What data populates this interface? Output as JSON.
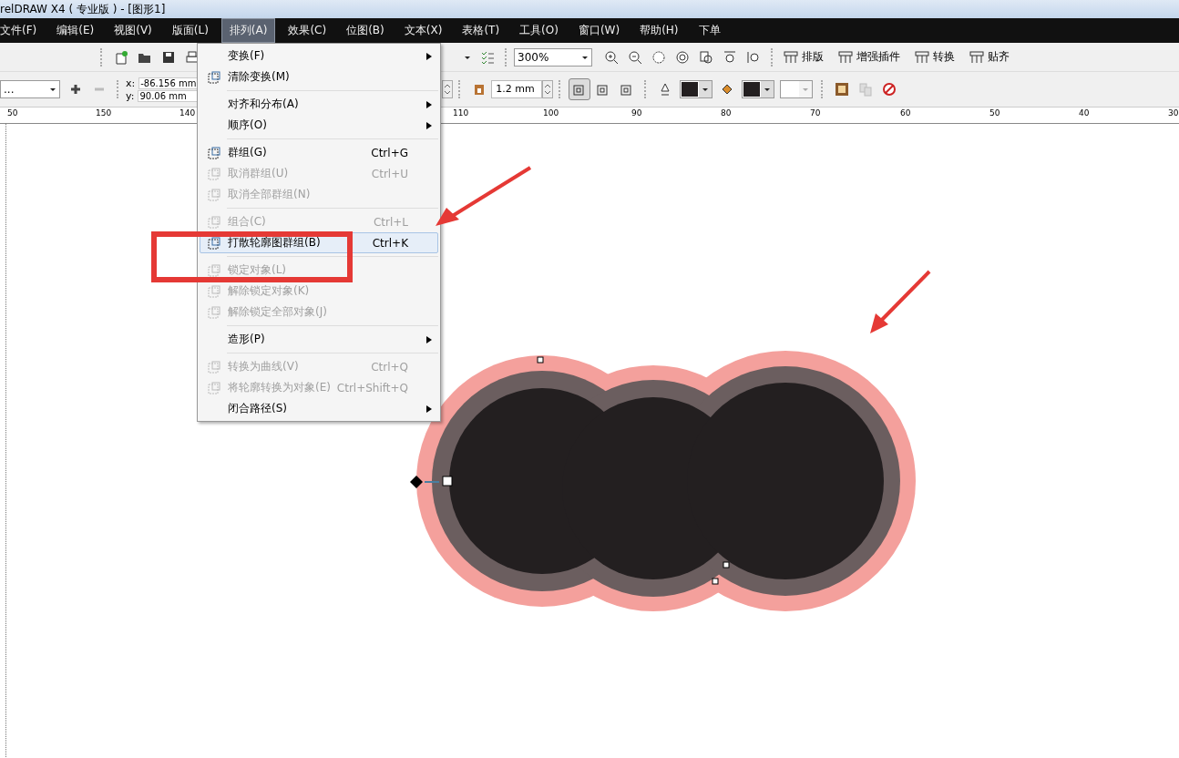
{
  "window": {
    "title": "relDRAW X4 ( 专业版 ) - [图形1]"
  },
  "menu_bar": [
    {
      "label": "文件(F)",
      "selected": false
    },
    {
      "label": "编辑(E)",
      "selected": false
    },
    {
      "label": "视图(V)",
      "selected": false
    },
    {
      "label": "版面(L)",
      "selected": false
    },
    {
      "label": "排列(A)",
      "selected": true
    },
    {
      "label": "效果(C)",
      "selected": false
    },
    {
      "label": "位图(B)",
      "selected": false
    },
    {
      "label": "文本(X)",
      "selected": false
    },
    {
      "label": "表格(T)",
      "selected": false
    },
    {
      "label": "工具(O)",
      "selected": false
    },
    {
      "label": "窗口(W)",
      "selected": false
    },
    {
      "label": "帮助(H)",
      "selected": false
    },
    {
      "label": "下单",
      "selected": false
    }
  ],
  "standard_toolbar": {
    "zoom": "300%",
    "buttons": [
      {
        "label": "排版"
      },
      {
        "label": "增强插件"
      },
      {
        "label": "转换"
      },
      {
        "label": "贴齐"
      }
    ]
  },
  "property_bar": {
    "object_combo": "...",
    "x_label": "x:",
    "x_value": "-86.156 mm",
    "y_label": "y:",
    "y_value": "90.06 mm",
    "outline_width": "1.2 mm",
    "toggles": [
      {
        "selected": true
      },
      {
        "selected": false
      },
      {
        "selected": false
      }
    ]
  },
  "ruler": {
    "labels": [
      "50",
      "150",
      "140",
      "110",
      "100",
      "90",
      "80",
      "70",
      "60",
      "50",
      "40",
      "30"
    ]
  },
  "dropdown_menu": {
    "groups": [
      [
        {
          "label": "变换(F)",
          "submenu": true,
          "disabled": false,
          "selected": false,
          "has_icon": false
        },
        {
          "label": "清除变换(M)",
          "submenu": false,
          "disabled": false,
          "selected": false,
          "has_icon": true
        }
      ],
      [
        {
          "label": "对齐和分布(A)",
          "submenu": true,
          "disabled": false,
          "selected": false,
          "has_icon": false
        },
        {
          "label": "顺序(O)",
          "submenu": true,
          "disabled": false,
          "selected": false,
          "has_icon": false
        }
      ],
      [
        {
          "label": "群组(G)",
          "shortcut": "Ctrl+G",
          "submenu": false,
          "disabled": false,
          "selected": false,
          "has_icon": true
        },
        {
          "label": "取消群组(U)",
          "shortcut": "Ctrl+U",
          "submenu": false,
          "disabled": true,
          "selected": false,
          "has_icon": true
        },
        {
          "label": "取消全部群组(N)",
          "submenu": false,
          "disabled": true,
          "selected": false,
          "has_icon": true
        }
      ],
      [
        {
          "label": "组合(C)",
          "shortcut": "Ctrl+L",
          "submenu": false,
          "disabled": true,
          "selected": false,
          "has_icon": true
        },
        {
          "label": "打散轮廓图群组(B)",
          "shortcut": "Ctrl+K",
          "submenu": false,
          "disabled": false,
          "selected": true,
          "has_icon": true
        }
      ],
      [
        {
          "label": "锁定对象(L)",
          "submenu": false,
          "disabled": true,
          "selected": false,
          "has_icon": true
        },
        {
          "label": "解除锁定对象(K)",
          "submenu": false,
          "disabled": true,
          "selected": false,
          "has_icon": true
        },
        {
          "label": "解除锁定全部对象(J)",
          "submenu": false,
          "disabled": true,
          "selected": false,
          "has_icon": true
        }
      ],
      [
        {
          "label": "造形(P)",
          "submenu": true,
          "disabled": false,
          "selected": false,
          "has_icon": false
        }
      ],
      [
        {
          "label": "转换为曲线(V)",
          "shortcut": "Ctrl+Q",
          "submenu": false,
          "disabled": true,
          "selected": false,
          "has_icon": true
        },
        {
          "label": "将轮廓转换为对象(E)",
          "shortcut": "Ctrl+Shift+Q",
          "submenu": false,
          "disabled": true,
          "selected": false,
          "has_icon": true
        },
        {
          "label": "闭合路径(S)",
          "submenu": true,
          "disabled": false,
          "selected": false,
          "has_icon": false
        }
      ]
    ]
  }
}
